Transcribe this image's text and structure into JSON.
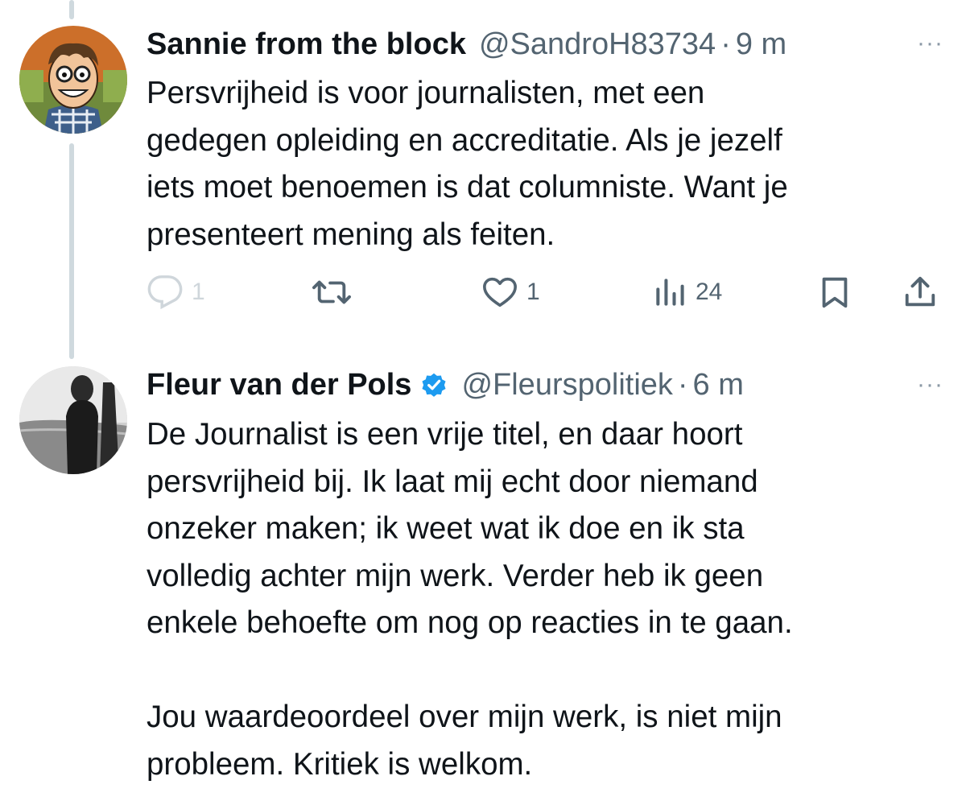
{
  "tweets": [
    {
      "author": "Sannie from the block",
      "handle": "@SandroH83734",
      "separator": "·",
      "time": "9 m",
      "more": "···",
      "text": [
        "Persvrijheid is voor journalisten, met een",
        "gedegen opleiding en accreditatie. Als je jezelf",
        "iets moet benoemen is dat columniste. Want je",
        "presenteert mening als feiten."
      ],
      "actions": {
        "reply_count": "1",
        "like_count": "1",
        "views_count": "24"
      },
      "icons": [
        "reply-icon",
        "retweet-icon",
        "like-icon",
        "views-icon",
        "bookmark-icon",
        "share-icon"
      ]
    },
    {
      "author": "Fleur van der Pols",
      "verified": true,
      "handle": "@Fleurspolitiek",
      "separator": "·",
      "time": "6 m",
      "more": "···",
      "text": [
        "De Journalist is een vrije titel, en daar hoort",
        "persvrijheid bij. Ik laat mij echt door niemand",
        "onzeker maken; ik weet wat ik doe en ik sta",
        "volledig achter mijn werk. Verder heb ik geen",
        "enkele behoefte om nog op reacties in te gaan.",
        "Jou waardeoordeel over mijn werk, is niet mijn",
        "probleem. Kritiek is welkom."
      ]
    }
  ],
  "colors": {
    "text": "#0f1419",
    "secondary": "#536471",
    "thread_line": "#cfd9de",
    "verified_badge": "#1d9bf0"
  }
}
